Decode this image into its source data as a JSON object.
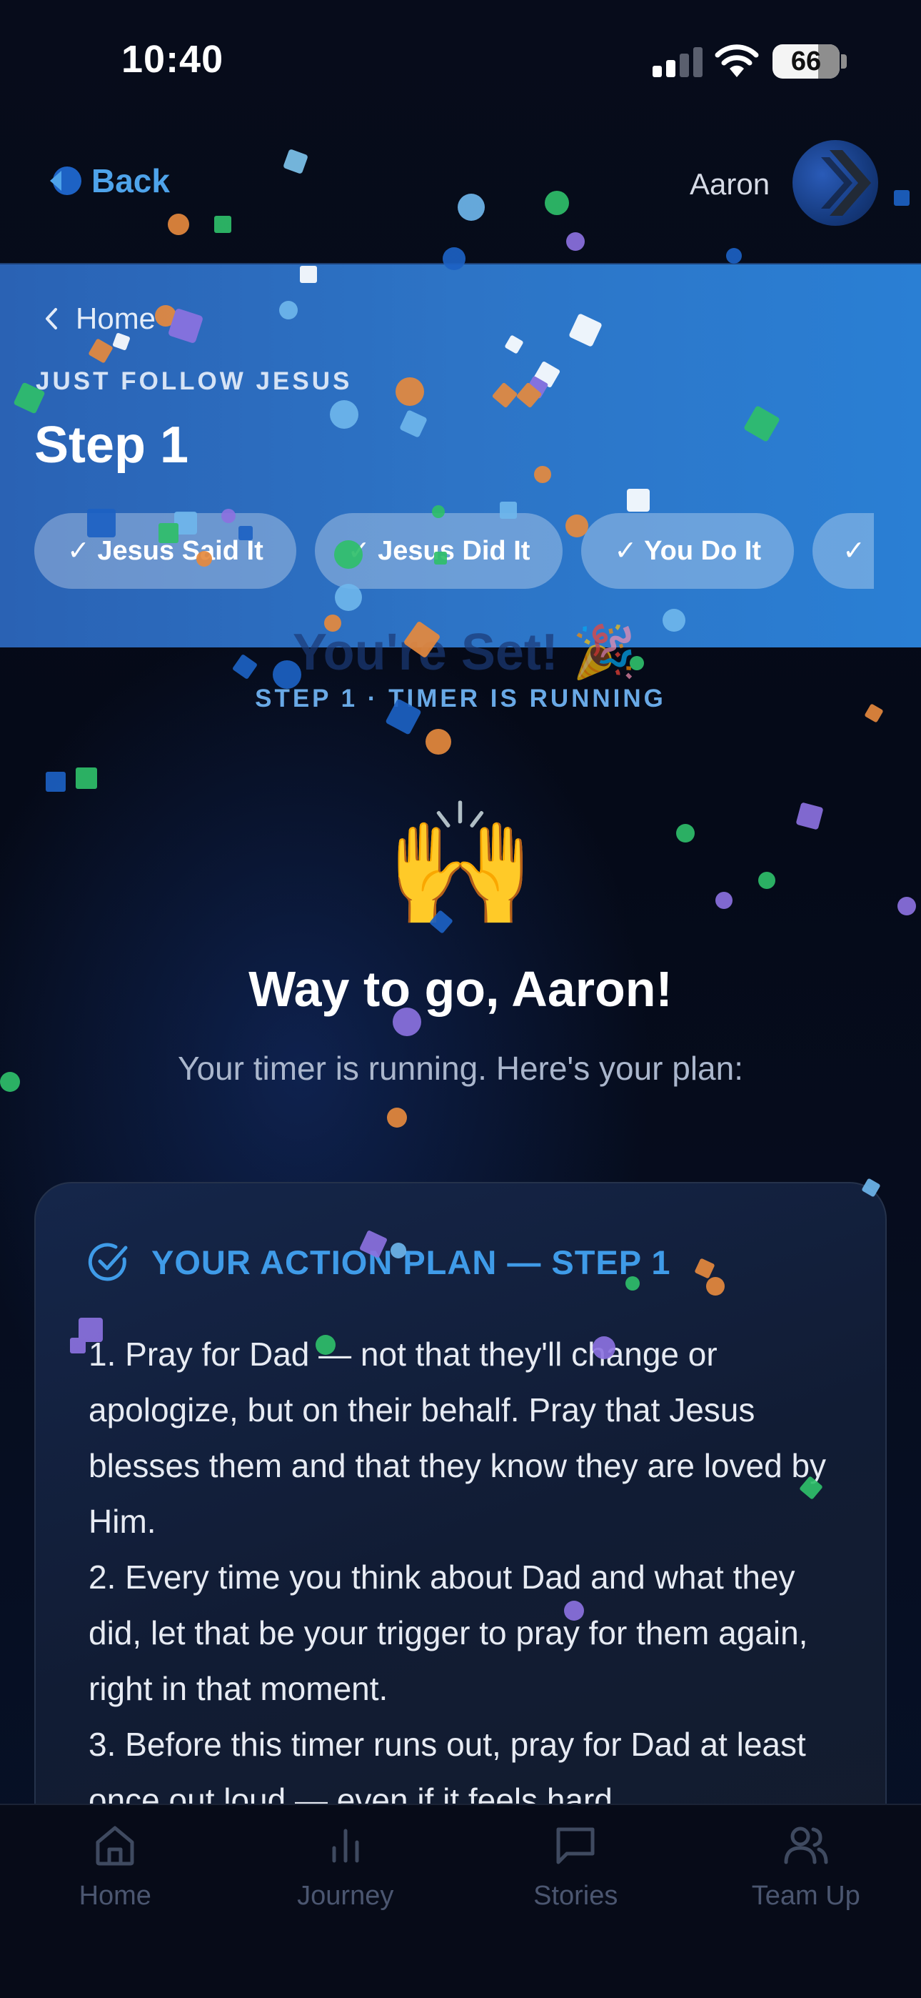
{
  "status_bar": {
    "time": "10:40",
    "battery": "66"
  },
  "nav": {
    "back_label": "Back",
    "user_name": "Aaron"
  },
  "header": {
    "breadcrumb": "Home",
    "section_label": "JUST FOLLOW JESUS",
    "title": "Step 1",
    "chips": [
      "✓ Jesus Said It",
      "✓ Jesus Did It",
      "✓ You Do It",
      "✓ ..."
    ]
  },
  "hero": {
    "ghost_text": "You're Set! 🎉",
    "timer_label": "STEP 1 · TIMER IS RUNNING",
    "emoji": "🙌",
    "headline": "Way to go, Aaron!",
    "subtitle": "Your timer is running. Here's your plan:"
  },
  "plan": {
    "title": "YOUR ACTION PLAN — STEP 1",
    "items": [
      "1. Pray for Dad — not that they'll change or apologize, but on their behalf. Pray that Jesus blesses them and that they know they are loved by Him.",
      "2. Every time you think about Dad and what they did, let that be your trigger to pray for them again, right in that moment.",
      "3. Before this timer runs out, pray for Dad at least once out loud — even if it feels hard."
    ]
  },
  "tabbar": {
    "tabs": [
      {
        "label": "Home",
        "icon": "home-icon"
      },
      {
        "label": "Journey",
        "icon": "bar-chart-icon"
      },
      {
        "label": "Stories",
        "icon": "chat-bubble-icon"
      },
      {
        "label": "Team Up",
        "icon": "users-icon"
      }
    ]
  },
  "colors": {
    "accent": "#4ea3ea",
    "header_band": "#2d74c6",
    "plan_title": "#3f9be8",
    "background": "#060b1a"
  }
}
